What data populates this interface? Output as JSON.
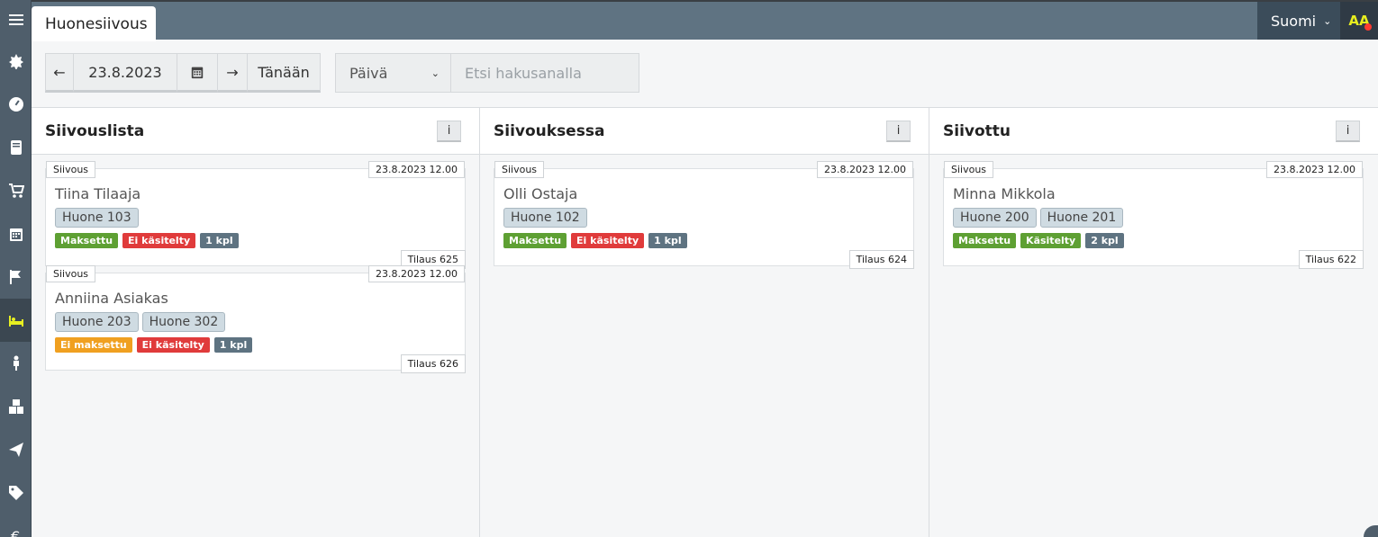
{
  "header": {
    "tab": "Huonesiivous",
    "language": "Suomi",
    "user_initials": "AA"
  },
  "sidebar": {
    "icons": [
      "menu-icon",
      "puzzle-icon",
      "dashboard-icon",
      "book-icon",
      "cart-icon",
      "calendar-icon",
      "flag-icon",
      "bed-icon",
      "person-icon",
      "boxes-icon",
      "send-icon",
      "tag-icon",
      "euro-icon"
    ],
    "active": "bed-icon"
  },
  "toolbar": {
    "prev": "←",
    "date": "23.8.2023",
    "next": "→",
    "today": "Tänään",
    "view": "Päivä",
    "search_placeholder": "Etsi hakusanalla"
  },
  "columns": [
    {
      "title": "Siivouslista",
      "info": "i",
      "cards": [
        {
          "type": "Siivous",
          "date": "23.8.2023 12.00",
          "name": "Tiina Tilaaja",
          "rooms": [
            "Huone 103"
          ],
          "badges": [
            {
              "text": "Maksettu",
              "color": "#5ea033"
            },
            {
              "text": "Ei käsitelty",
              "color": "#e03b3b"
            },
            {
              "text": "1 kpl",
              "color": "#5e7381"
            }
          ],
          "order": "Tilaus 625"
        },
        {
          "type": "Siivous",
          "date": "23.8.2023 12.00",
          "name": "Anniina Asiakas",
          "rooms": [
            "Huone 203",
            "Huone 302"
          ],
          "badges": [
            {
              "text": "Ei maksettu",
              "color": "#f0a020"
            },
            {
              "text": "Ei käsitelty",
              "color": "#e03b3b"
            },
            {
              "text": "1 kpl",
              "color": "#5e7381"
            }
          ],
          "order": "Tilaus 626"
        }
      ]
    },
    {
      "title": "Siivouksessa",
      "info": "i",
      "cards": [
        {
          "type": "Siivous",
          "date": "23.8.2023 12.00",
          "name": "Olli Ostaja",
          "rooms": [
            "Huone 102"
          ],
          "badges": [
            {
              "text": "Maksettu",
              "color": "#5ea033"
            },
            {
              "text": "Ei käsitelty",
              "color": "#e03b3b"
            },
            {
              "text": "1 kpl",
              "color": "#5e7381"
            }
          ],
          "order": "Tilaus 624"
        }
      ]
    },
    {
      "title": "Siivottu",
      "info": "i",
      "cards": [
        {
          "type": "Siivous",
          "date": "23.8.2023 12.00",
          "name": "Minna Mikkola",
          "rooms": [
            "Huone 200",
            "Huone 201"
          ],
          "badges": [
            {
              "text": "Maksettu",
              "color": "#5ea033"
            },
            {
              "text": "Käsitelty",
              "color": "#5ea033"
            },
            {
              "text": "2 kpl",
              "color": "#5e7381"
            }
          ],
          "order": "Tilaus 622"
        }
      ]
    }
  ]
}
